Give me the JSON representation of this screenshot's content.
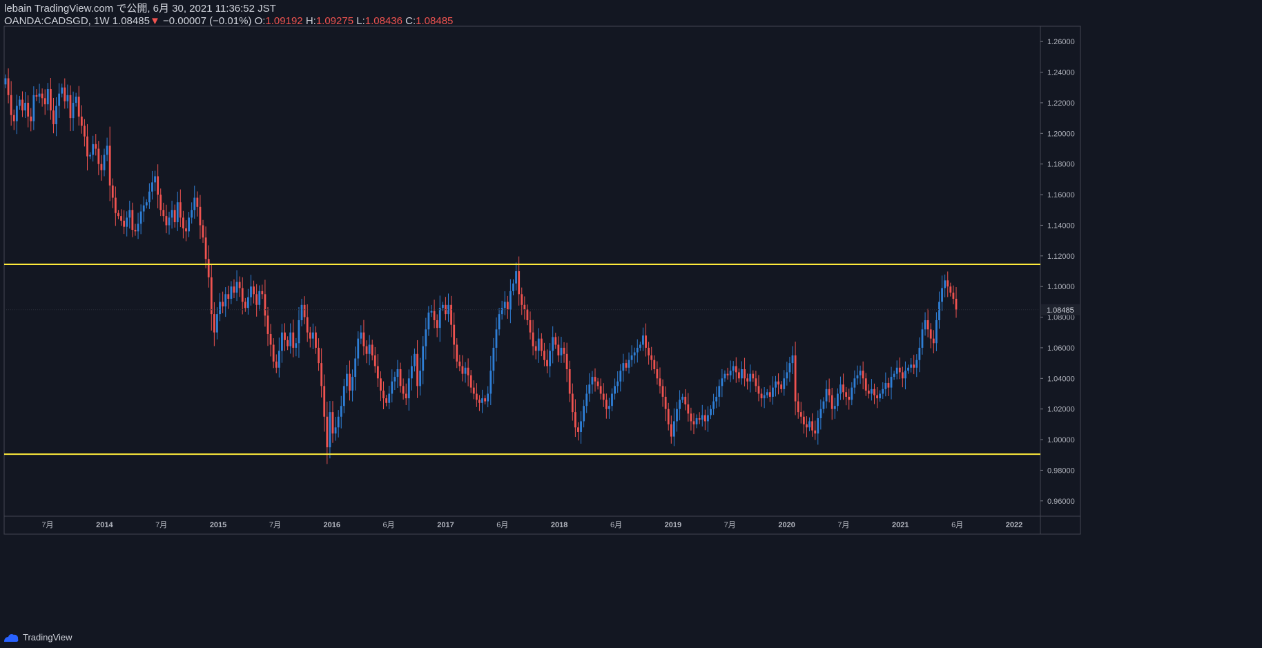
{
  "header": {
    "published": "lebain TradingView.com で公開, 6月 30, 2021 11:36:52 JST",
    "symbol": "OANDA:CADSGD, 1W",
    "last": "1.08485",
    "change_arrow": "▼",
    "change": "−0.00007 (−0.01%)",
    "o_label": "O:",
    "o_value": "1.09192",
    "h_label": "H:",
    "h_value": "1.09275",
    "l_label": "L:",
    "l_value": "1.08436",
    "c_label": "C:",
    "c_value": "1.08485"
  },
  "footer": {
    "brand": "TradingView"
  },
  "colors": {
    "background": "#131722",
    "up": "#2962ff",
    "up_body": "#2f7fd6",
    "down": "#ef5350",
    "level_line": "#ffeb3b",
    "price_tag_bg": "#1e222d"
  },
  "chart_data": {
    "type": "candlestick",
    "title": "OANDA:CADSGD, 1W",
    "ylim": [
      0.95,
      1.27
    ],
    "yticks": [
      "0.96000",
      "0.98000",
      "1.00000",
      "1.02000",
      "1.04000",
      "1.06000",
      "1.08000",
      "1.10000",
      "1.12000",
      "1.14000",
      "1.16000",
      "1.18000",
      "1.20000",
      "1.22000",
      "1.24000",
      "1.26000"
    ],
    "current_price": "1.08485",
    "xticks": [
      "7月",
      "2014",
      "7月",
      "2015",
      "7月",
      "2016",
      "6月",
      "2017",
      "6月",
      "2018",
      "6月",
      "2019",
      "7月",
      "2020",
      "7月",
      "2021",
      "6月",
      "2022"
    ],
    "horizontal_lines": [
      1.1145,
      0.9905
    ],
    "series": [
      {
        "name": "CADSGD weekly close",
        "start": "2013-02",
        "closes": [
          1.236,
          1.225,
          1.212,
          1.208,
          1.218,
          1.222,
          1.215,
          1.22,
          1.211,
          1.208,
          1.225,
          1.224,
          1.226,
          1.223,
          1.219,
          1.229,
          1.215,
          1.206,
          1.218,
          1.226,
          1.23,
          1.221,
          1.225,
          1.21,
          1.22,
          1.224,
          1.211,
          1.205,
          1.198,
          1.185,
          1.186,
          1.193,
          1.19,
          1.18,
          1.176,
          1.186,
          1.192,
          1.166,
          1.158,
          1.148,
          1.146,
          1.143,
          1.139,
          1.145,
          1.15,
          1.137,
          1.136,
          1.141,
          1.149,
          1.153,
          1.155,
          1.162,
          1.168,
          1.172,
          1.16,
          1.15,
          1.146,
          1.14,
          1.145,
          1.15,
          1.142,
          1.155,
          1.145,
          1.138,
          1.136,
          1.145,
          1.15,
          1.158,
          1.152,
          1.14,
          1.132,
          1.118,
          1.106,
          1.082,
          1.07,
          1.082,
          1.09,
          1.087,
          1.095,
          1.092,
          1.1,
          1.096,
          1.103,
          1.099,
          1.09,
          1.086,
          1.093,
          1.1,
          1.095,
          1.088,
          1.097,
          1.095,
          1.081,
          1.069,
          1.062,
          1.051,
          1.047,
          1.058,
          1.07,
          1.065,
          1.061,
          1.07,
          1.06,
          1.063,
          1.078,
          1.088,
          1.08,
          1.07,
          1.066,
          1.07,
          1.06,
          1.05,
          1.035,
          1.015,
          0.995,
          1.018,
          1.004,
          1.008,
          1.015,
          1.022,
          1.035,
          1.043,
          1.032,
          1.041,
          1.053,
          1.066,
          1.07,
          1.061,
          1.056,
          1.062,
          1.055,
          1.048,
          1.04,
          1.032,
          1.027,
          1.024,
          1.03,
          1.038,
          1.041,
          1.046,
          1.035,
          1.03,
          1.027,
          1.04,
          1.048,
          1.056,
          1.035,
          1.045,
          1.061,
          1.072,
          1.083,
          1.084,
          1.078,
          1.073,
          1.086,
          1.088,
          1.082,
          1.088,
          1.075,
          1.062,
          1.051,
          1.048,
          1.043,
          1.047,
          1.042,
          1.034,
          1.03,
          1.026,
          1.024,
          1.027,
          1.025,
          1.03,
          1.045,
          1.06,
          1.072,
          1.082,
          1.086,
          1.09,
          1.085,
          1.097,
          1.102,
          1.11,
          1.095,
          1.088,
          1.085,
          1.078,
          1.07,
          1.061,
          1.058,
          1.066,
          1.058,
          1.052,
          1.048,
          1.058,
          1.067,
          1.062,
          1.055,
          1.06,
          1.056,
          1.046,
          1.03,
          1.018,
          1.008,
          1.005,
          1.012,
          1.022,
          1.03,
          1.036,
          1.041,
          1.038,
          1.035,
          1.03,
          1.026,
          1.02,
          1.022,
          1.03,
          1.035,
          1.038,
          1.045,
          1.05,
          1.047,
          1.052,
          1.055,
          1.057,
          1.06,
          1.062,
          1.068,
          1.06,
          1.055,
          1.052,
          1.046,
          1.04,
          1.035,
          1.028,
          1.02,
          1.01,
          1.002,
          1.012,
          1.02,
          1.026,
          1.028,
          1.023,
          1.017,
          1.012,
          1.01,
          1.014,
          1.013,
          1.016,
          1.012,
          1.016,
          1.02,
          1.025,
          1.028,
          1.035,
          1.04,
          1.043,
          1.042,
          1.045,
          1.048,
          1.044,
          1.04,
          1.046,
          1.04,
          1.038,
          1.043,
          1.04,
          1.035,
          1.03,
          1.027,
          1.029,
          1.031,
          1.028,
          1.034,
          1.038,
          1.036,
          1.033,
          1.04,
          1.044,
          1.05,
          1.055,
          1.025,
          1.018,
          1.015,
          1.01,
          1.008,
          1.012,
          1.006,
          1.004,
          1.014,
          1.02,
          1.025,
          1.033,
          1.029,
          1.02,
          1.022,
          1.03,
          1.036,
          1.031,
          1.028,
          1.026,
          1.034,
          1.04,
          1.042,
          1.045,
          1.04,
          1.032,
          1.03,
          1.033,
          1.029,
          1.027,
          1.03,
          1.033,
          1.037,
          1.034,
          1.041,
          1.043,
          1.047,
          1.044,
          1.04,
          1.045,
          1.047,
          1.049,
          1.047,
          1.052,
          1.06,
          1.072,
          1.078,
          1.072,
          1.066,
          1.063,
          1.078,
          1.09,
          1.099,
          1.104,
          1.1,
          1.096,
          1.092,
          1.085
        ]
      }
    ]
  }
}
